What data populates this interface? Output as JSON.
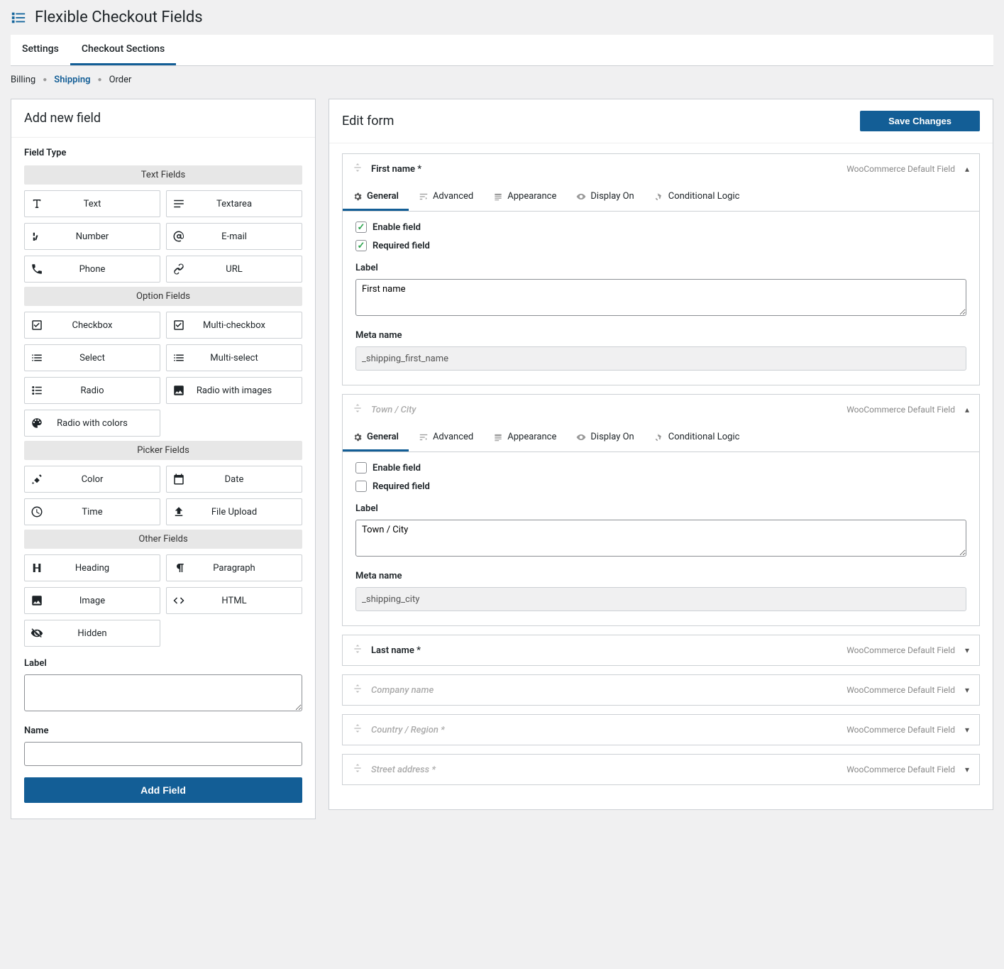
{
  "page_title": "Flexible Checkout Fields",
  "main_tabs": [
    "Settings",
    "Checkout Sections"
  ],
  "main_tabs_active": 1,
  "sub_tabs": [
    "Billing",
    "Shipping",
    "Order"
  ],
  "sub_tabs_active": 1,
  "left": {
    "title": "Add new field",
    "field_type_label": "Field Type",
    "groups": [
      {
        "name": "Text Fields",
        "types": [
          {
            "label": "Text",
            "icon": "text"
          },
          {
            "label": "Textarea",
            "icon": "textarea"
          },
          {
            "label": "Number",
            "icon": "number"
          },
          {
            "label": "E-mail",
            "icon": "email"
          },
          {
            "label": "Phone",
            "icon": "phone"
          },
          {
            "label": "URL",
            "icon": "url"
          }
        ]
      },
      {
        "name": "Option Fields",
        "types": [
          {
            "label": "Checkbox",
            "icon": "checkbox"
          },
          {
            "label": "Multi-checkbox",
            "icon": "multicheck"
          },
          {
            "label": "Select",
            "icon": "select"
          },
          {
            "label": "Multi-select",
            "icon": "multiselect"
          },
          {
            "label": "Radio",
            "icon": "radio"
          },
          {
            "label": "Radio with images",
            "icon": "radioimg"
          },
          {
            "label": "Radio with colors",
            "icon": "radiocol"
          }
        ]
      },
      {
        "name": "Picker Fields",
        "types": [
          {
            "label": "Color",
            "icon": "color"
          },
          {
            "label": "Date",
            "icon": "date"
          },
          {
            "label": "Time",
            "icon": "time"
          },
          {
            "label": "File Upload",
            "icon": "upload"
          }
        ]
      },
      {
        "name": "Other Fields",
        "types": [
          {
            "label": "Heading",
            "icon": "heading"
          },
          {
            "label": "Paragraph",
            "icon": "paragraph"
          },
          {
            "label": "Image",
            "icon": "image"
          },
          {
            "label": "HTML",
            "icon": "html"
          },
          {
            "label": "Hidden",
            "icon": "hidden"
          }
        ]
      }
    ],
    "label_label": "Label",
    "label_value": "",
    "name_label": "Name",
    "name_value": "",
    "add_button": "Add Field"
  },
  "right": {
    "title": "Edit form",
    "save_button": "Save Changes",
    "default_tag": "WooCommerce Default Field",
    "field_tabs": [
      "General",
      "Advanced",
      "Appearance",
      "Display On",
      "Conditional Logic"
    ],
    "labels": {
      "enable": "Enable field",
      "required": "Required field",
      "label": "Label",
      "meta": "Meta name"
    },
    "fields": [
      {
        "title": "First name",
        "required_star": true,
        "muted": false,
        "expanded": true,
        "enable": true,
        "required": true,
        "label_value": "First name",
        "meta": "_shipping_first_name"
      },
      {
        "title": "Town / City",
        "required_star": false,
        "muted": true,
        "expanded": true,
        "enable": false,
        "required": false,
        "label_value": "Town / City",
        "meta": "_shipping_city"
      },
      {
        "title": "Last name",
        "required_star": true,
        "muted": false,
        "expanded": false
      },
      {
        "title": "Company name",
        "required_star": false,
        "muted": true,
        "expanded": false
      },
      {
        "title": "Country / Region",
        "required_star": true,
        "muted": true,
        "expanded": false
      },
      {
        "title": "Street address",
        "required_star": true,
        "muted": true,
        "expanded": false
      }
    ]
  }
}
